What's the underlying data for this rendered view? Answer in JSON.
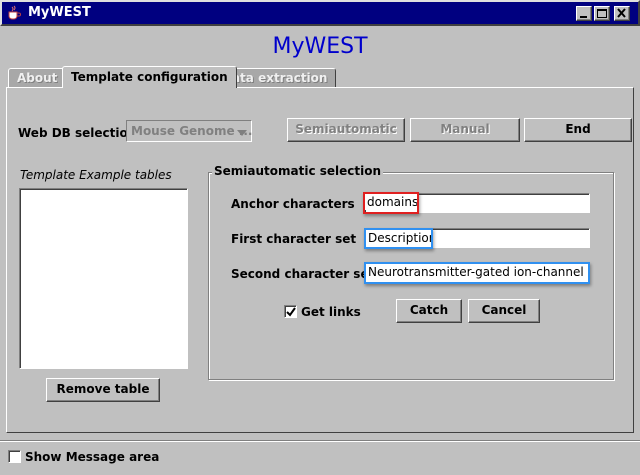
{
  "window": {
    "title": "MyWEST",
    "controls": [
      "minimize-icon",
      "maximize-icon",
      "close-icon"
    ]
  },
  "app_heading": "MyWEST",
  "tabs": [
    {
      "label": "About",
      "active": false
    },
    {
      "label": "Template configuration",
      "active": true
    },
    {
      "label": "Data extraction",
      "active": false
    }
  ],
  "webdb": {
    "label": "Web DB selection",
    "selected": "Mouse Genome ..."
  },
  "mode_buttons": {
    "semiautomatic": "Semiautomatic",
    "manual": "Manual",
    "end": "End"
  },
  "template_tables": {
    "label": "Template Example tables",
    "items": [],
    "remove_label": "Remove table"
  },
  "semi": {
    "title": "Semiautomatic selection",
    "anchor_label": "Anchor characters",
    "anchor_value": "domains",
    "first_label": "First character set",
    "first_value": "Description",
    "second_label": "Second character set",
    "second_value": "Neurotransmitter-gated ion-channel liga",
    "get_links_label": "Get links",
    "get_links_checked": true,
    "catch_label": "Catch",
    "cancel_label": "Cancel"
  },
  "footer": {
    "show_message_label": "Show Message area",
    "show_message_checked": false
  },
  "colors": {
    "title_bar": "#000080",
    "heading": "#0000cc",
    "highlight_red": "#e02020",
    "highlight_blue": "#3090f0"
  }
}
